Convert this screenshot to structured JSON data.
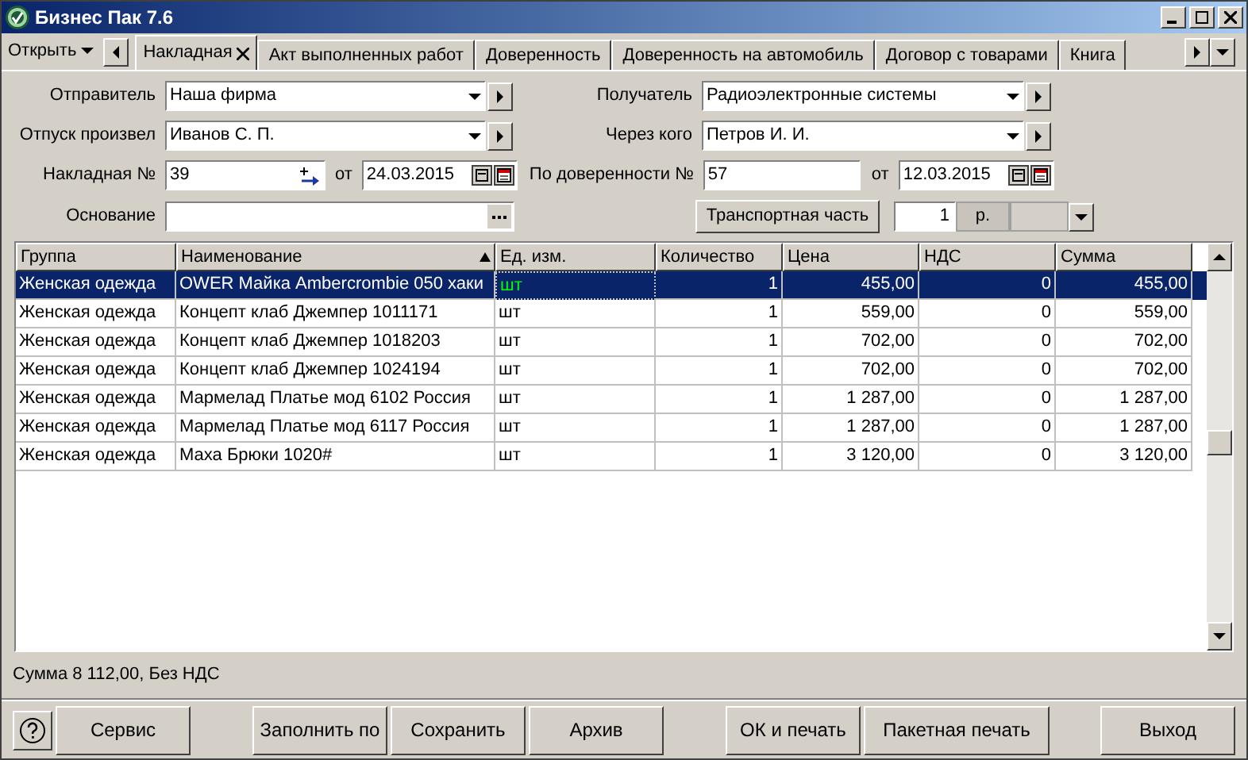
{
  "window": {
    "title": "Бизнес Пак 7.6"
  },
  "open_menu": {
    "label": "Открыть"
  },
  "tabs": [
    {
      "label": "Накладная",
      "selected": true
    },
    {
      "label": "Акт выполненных работ",
      "selected": false
    },
    {
      "label": "Доверенность",
      "selected": false
    },
    {
      "label": "Доверенность на автомобиль",
      "selected": false
    },
    {
      "label": "Договор с товарами",
      "selected": false
    },
    {
      "label": "Книга",
      "selected": false
    }
  ],
  "form": {
    "sender": {
      "label": "Отправитель",
      "value": "Наша фирма"
    },
    "receiver": {
      "label": "Получатель",
      "value": "Радиоэлектронные системы"
    },
    "released_by": {
      "label": "Отпуск произвел",
      "value": "Иванов С. П."
    },
    "via": {
      "label": "Через кого",
      "value": "Петров И. И."
    },
    "invoice_no": {
      "label": "Накладная №",
      "value": "39",
      "date_label": "от",
      "date": "24.03.2015"
    },
    "proxy_no": {
      "label": "По доверенности №",
      "value": "57",
      "date_label": "от",
      "date": "12.03.2015"
    },
    "basis": {
      "label": "Основание"
    },
    "transport_button": "Транспортная часть",
    "transport_qty": "1",
    "currency": "р."
  },
  "table": {
    "columns": [
      {
        "label": "Группа",
        "sorted": false,
        "focused": false
      },
      {
        "label": "Наименование",
        "sorted": true,
        "focused": false
      },
      {
        "label": "Ед. изм.",
        "sorted": false,
        "focused": true
      },
      {
        "label": "Количество",
        "sorted": false,
        "focused": false
      },
      {
        "label": "Цена",
        "sorted": false,
        "focused": false
      },
      {
        "label": "НДС",
        "sorted": false,
        "focused": false
      },
      {
        "label": "Сумма",
        "sorted": false,
        "focused": false
      }
    ],
    "rows": [
      {
        "selected": true,
        "cells": [
          "Женская одежда",
          "OWER Майка Ambercrombie 050 хаки",
          "шт",
          "1",
          "455,00",
          "0",
          "455,00"
        ]
      },
      {
        "selected": false,
        "cells": [
          "Женская одежда",
          "Концепт клаб Джемпер 1011171",
          "шт",
          "1",
          "559,00",
          "0",
          "559,00"
        ]
      },
      {
        "selected": false,
        "cells": [
          "Женская одежда",
          "Концепт клаб Джемпер 1018203",
          "шт",
          "1",
          "702,00",
          "0",
          "702,00"
        ]
      },
      {
        "selected": false,
        "cells": [
          "Женская одежда",
          "Концепт клаб Джемпер 1024194",
          "шт",
          "1",
          "702,00",
          "0",
          "702,00"
        ]
      },
      {
        "selected": false,
        "cells": [
          "Женская одежда",
          "Мармелад Платье мод 6102 Россия",
          "шт",
          "1",
          "1 287,00",
          "0",
          "1 287,00"
        ]
      },
      {
        "selected": false,
        "cells": [
          "Женская одежда",
          "Мармелад Платье мод 6117 Россия",
          "шт",
          "1",
          "1 287,00",
          "0",
          "1 287,00"
        ]
      },
      {
        "selected": false,
        "cells": [
          "Женская одежда",
          "Маха Брюки 1020#",
          "шт",
          "1",
          "3 120,00",
          "0",
          "3 120,00"
        ]
      }
    ]
  },
  "status_bar": "Сумма 8 112,00, Без НДС",
  "button_groups": [
    [
      "Сервис"
    ],
    [
      "Заполнить по",
      "Сохранить",
      "Архив"
    ],
    [
      "ОК и печать",
      "Пакетная печать"
    ],
    [
      "Выход"
    ]
  ]
}
